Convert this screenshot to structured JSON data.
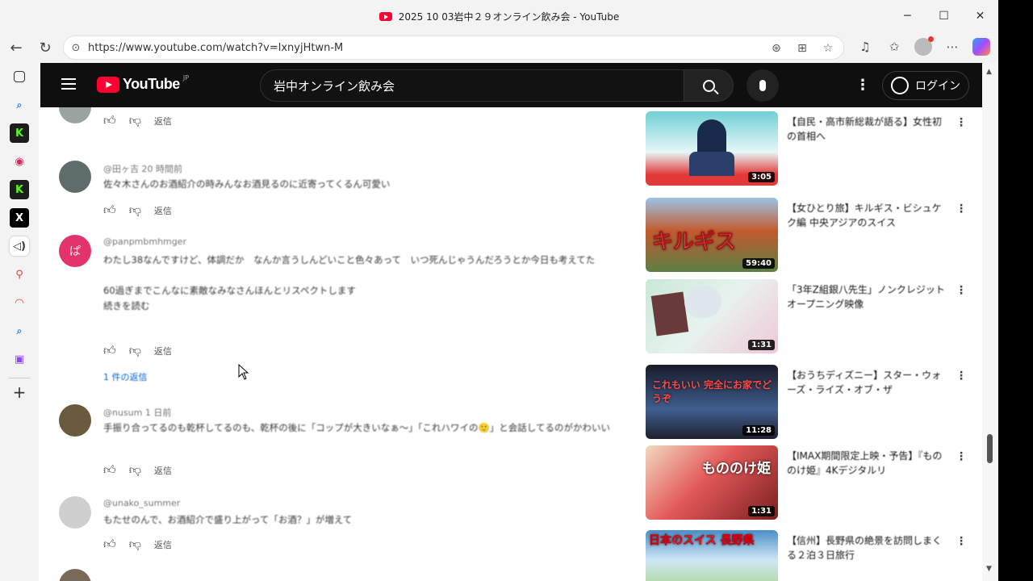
{
  "browser": {
    "window_title": "2025 10 03岩中２９オンライン飲み会 - YouTube",
    "url": "https://www.youtube.com/watch?v=lxnyjHtwn-M",
    "controls": {
      "minimize": "─",
      "maximize": "☐",
      "close": "✕"
    }
  },
  "youtube": {
    "logo_text": "YouTube",
    "logo_region": "JP",
    "search_query": "岩中オンライン飲み会",
    "login_label": "ログイン"
  },
  "comments": [
    {
      "author": "",
      "text": "",
      "likes": "",
      "reply_label": "返信",
      "avatar_color": "#9aa3a0"
    },
    {
      "author": "@田ヶ吉 20 時間前",
      "text": "佐々木さんのお酒紹介の時みんなお酒見るのに近寄ってくるん可愛い",
      "likes": "",
      "reply_label": "返信",
      "avatar_color": "#5f6d6a"
    },
    {
      "author": "@panpmbmhmger",
      "text": "わたし38なんですけど、体調だか　なんか言うしんどいこと色々あって　いつ死んじゃうんだろうとか今日も考えてた\n\n60過ぎまでこんなに素敵なみなさんほんとリスペクトします\n続きを読む",
      "likes": "",
      "reply_label": "返信",
      "replies": "1 件の返信",
      "avatar_color": "#e2336b",
      "avatar_letter": "ぱ"
    },
    {
      "author": "@nusum 1 日前",
      "text": "手振り合ってるのも乾杯してるのも、乾杯の後に「コップが大きいなぁ〜」「これハワイの🙂」と会話してるのがかわいい",
      "likes": "",
      "reply_label": "返信",
      "avatar_color": "#6b5b3e"
    },
    {
      "author": "@unako_summer",
      "text": "もたせのんで、お酒紹介で盛り上がって「お酒？」が増えて",
      "likes": "",
      "reply_label": "返信",
      "avatar_color": "#cfcfcf"
    }
  ],
  "recommendations": [
    {
      "title": "【自民・高市新総裁が語る】女性初の首相へ",
      "channel": "",
      "meta": "",
      "duration": "3:05",
      "thumb_colors": [
        "#5cc6c9",
        "#e23a3a"
      ],
      "thumb_caption": ""
    },
    {
      "title": "【女ひとり旅】キルギス・ビシュケク編 中央アジアのスイス",
      "channel": "",
      "meta": "",
      "duration": "59:40",
      "thumb_colors": [
        "#c35a2e",
        "#5b7f45"
      ],
      "thumb_caption": "キルギス"
    },
    {
      "title": "「3年Z組銀八先生」ノンクレジットオープニング映像",
      "channel": "",
      "meta": "",
      "duration": "1:31",
      "thumb_colors": [
        "#c9e8d8",
        "#f1c6d8"
      ],
      "thumb_caption": ""
    },
    {
      "title": "【おうちディズニー】スター・ウォーズ・ライズ・オブ・ザ",
      "channel": "",
      "meta": "",
      "duration": "11:28",
      "thumb_colors": [
        "#1a1a2a",
        "#3f5f8f"
      ],
      "thumb_caption": "これもいい 完全にお家でどうぞ"
    },
    {
      "title": "【IMAX期間限定上映・予告】『もののけ姫』4Kデジタルリ",
      "channel": "",
      "meta": "",
      "duration": "1:31",
      "thumb_colors": [
        "#7a1f1f",
        "#e35858"
      ],
      "thumb_caption": "もののけ姫"
    },
    {
      "title": "【信州】長野県の絶景を訪問しまくる２泊３日旅行",
      "channel": "",
      "meta": "",
      "duration": "",
      "thumb_colors": [
        "#4a8fc7",
        "#9bd06a"
      ],
      "thumb_caption": "日本のスイス 長野県"
    }
  ]
}
